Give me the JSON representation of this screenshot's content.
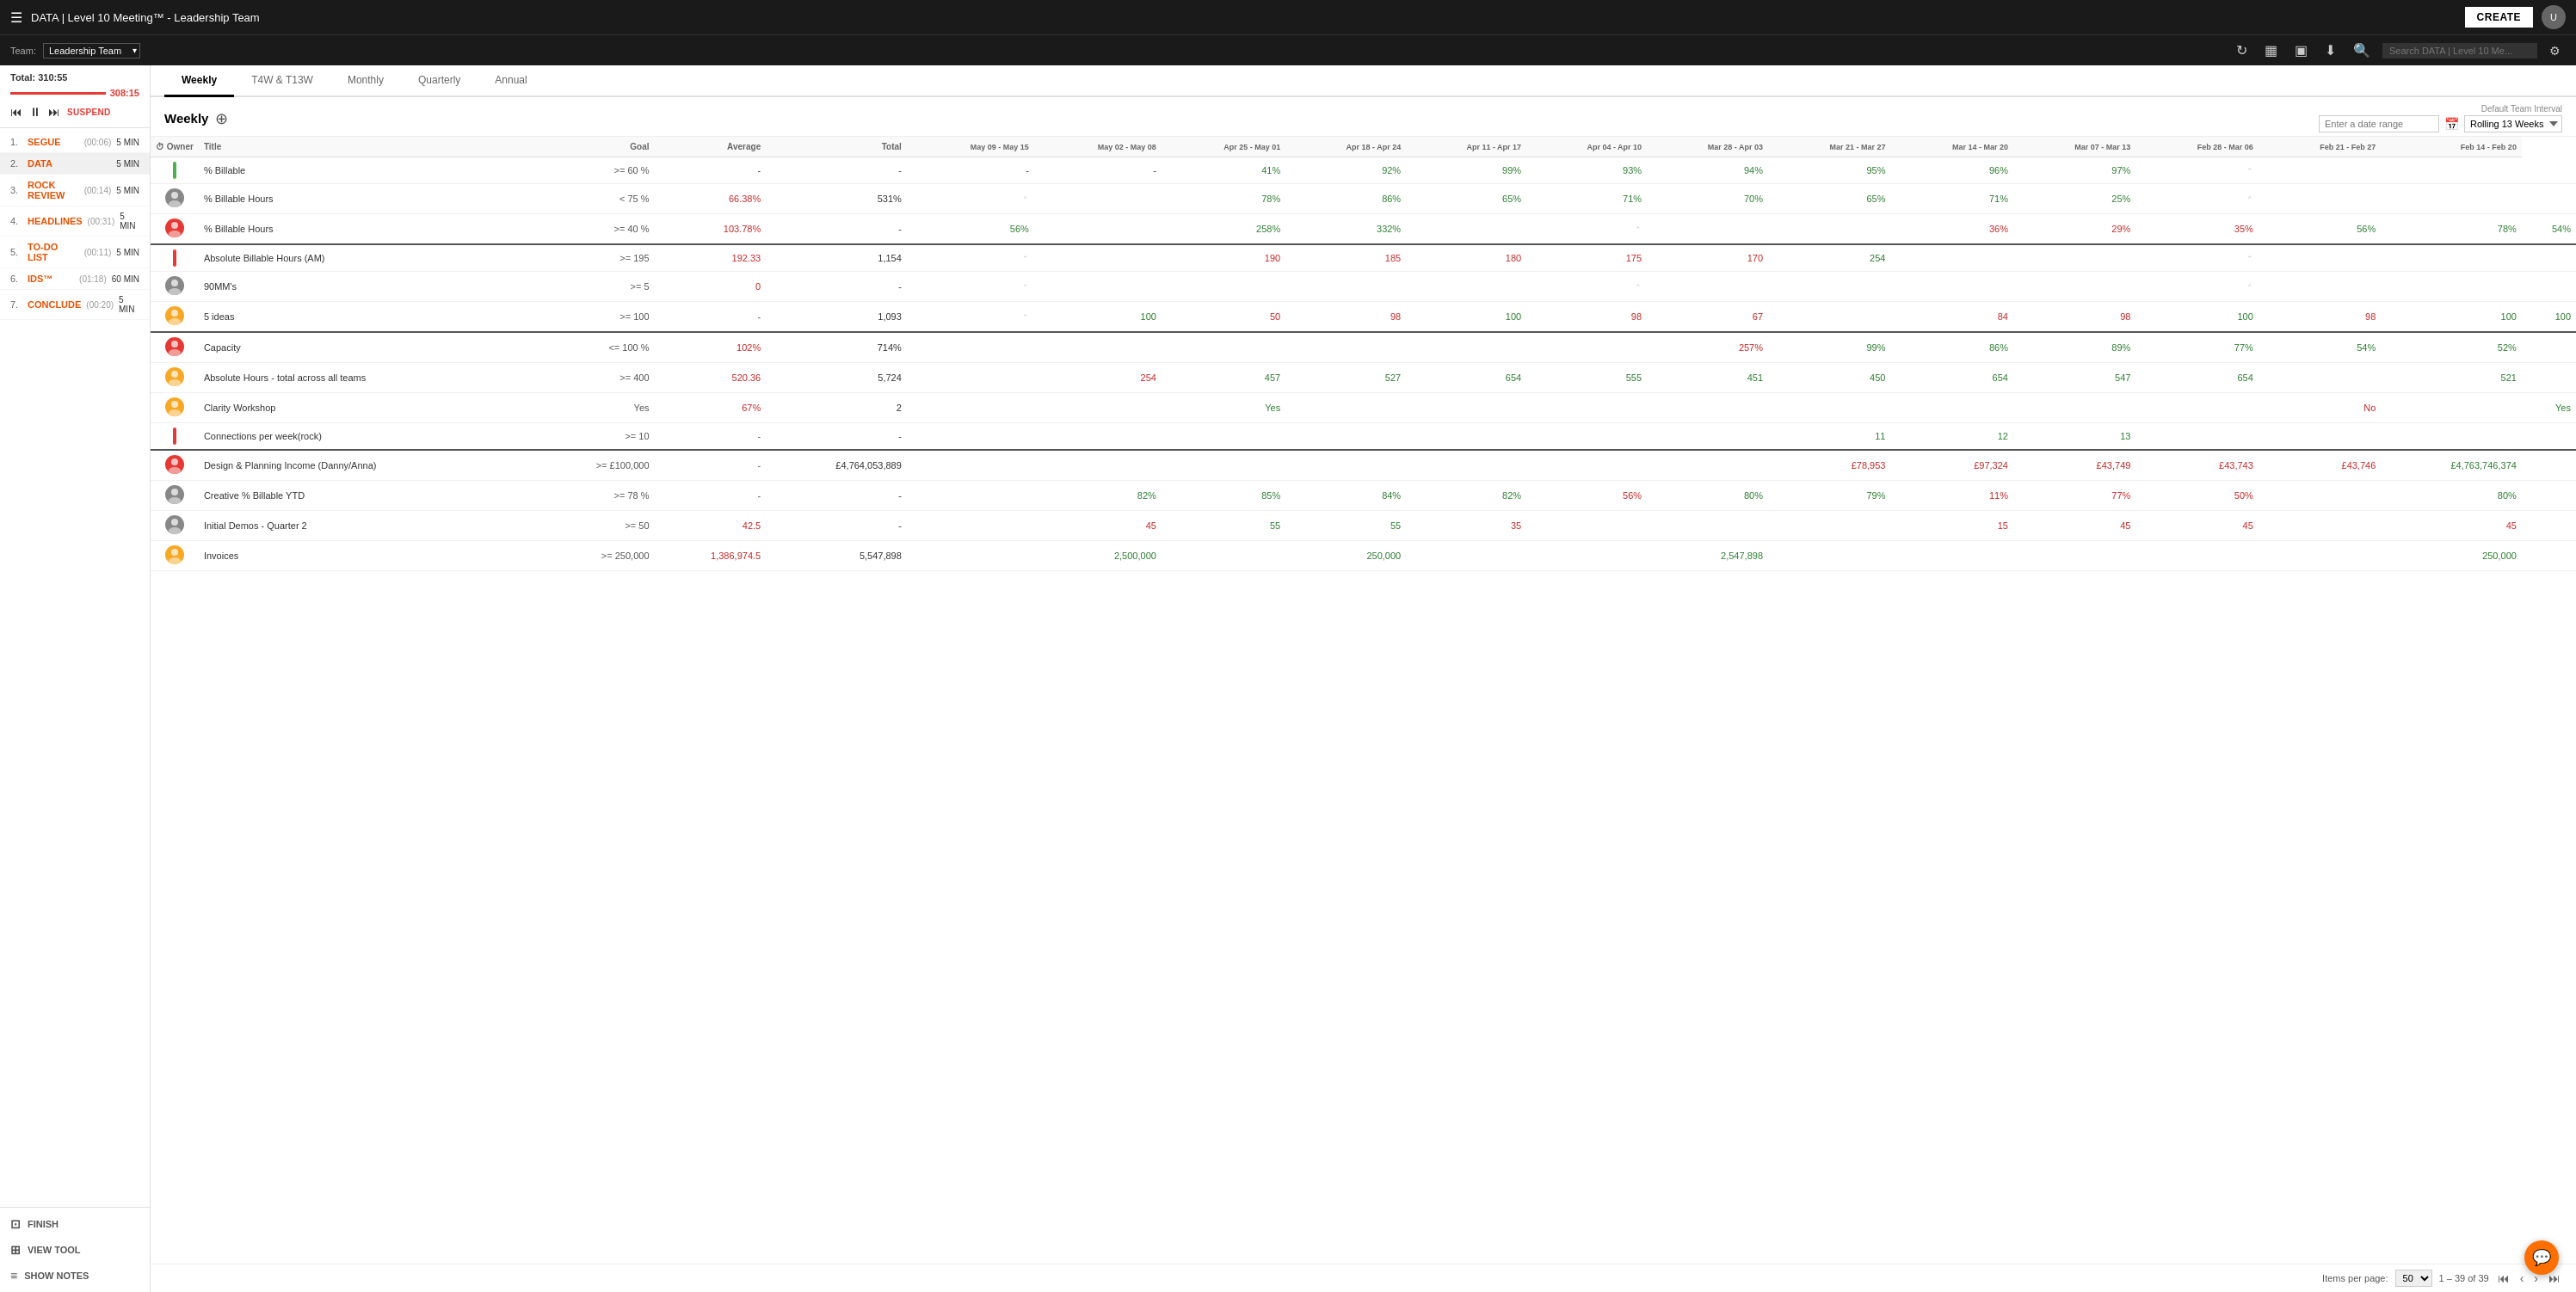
{
  "topbar": {
    "menu_icon": "☰",
    "title": "DATA | Level 10 Meeting™ - Leadership Team",
    "create_label": "CREATE"
  },
  "teambar": {
    "team_label": "Team:",
    "team_name": "Leadership Team",
    "search_placeholder": "Search DATA | Level 10 Me...",
    "refresh_icon": "↻",
    "chart_icon": "▦",
    "screen_icon": "▣",
    "download_icon": "⬇",
    "search_icon": "🔍",
    "gear_icon": "⚙"
  },
  "sidebar": {
    "total_label": "Total:",
    "total_value": "310:55",
    "timer_value": "308:15",
    "items": [
      {
        "num": "1.",
        "name": "SEGUE",
        "time": "(00:06)",
        "dur": "5 MIN",
        "color": "orange"
      },
      {
        "num": "2.",
        "name": "DATA",
        "time": "",
        "dur": "5 MIN",
        "color": "orange",
        "active": true
      },
      {
        "num": "3.",
        "name": "ROCK REVIEW",
        "time": "(00:14)",
        "dur": "5 MIN",
        "color": "orange"
      },
      {
        "num": "4.",
        "name": "HEADLINES",
        "time": "(00:31)",
        "dur": "5 MIN",
        "color": "orange"
      },
      {
        "num": "5.",
        "name": "TO-DO LIST",
        "time": "(00:11)",
        "dur": "5 MIN",
        "color": "orange"
      },
      {
        "num": "6.",
        "name": "IDS™",
        "time": "(01:18)",
        "dur": "60 MIN",
        "color": "orange"
      },
      {
        "num": "7.",
        "name": "CONCLUDE",
        "time": "(00:20)",
        "dur": "5 MIN",
        "color": "orange"
      }
    ],
    "footer": [
      {
        "label": "FINISH",
        "icon": "⊡"
      },
      {
        "label": "VIEW TOOL",
        "icon": "⊞"
      },
      {
        "label": "SHOW NOTES",
        "icon": "≡"
      }
    ]
  },
  "tabs": [
    {
      "label": "Weekly",
      "active": true
    },
    {
      "label": "T4W & T13W",
      "active": false
    },
    {
      "label": "Monthly",
      "active": false
    },
    {
      "label": "Quarterly",
      "active": false
    },
    {
      "label": "Annual",
      "active": false
    }
  ],
  "weekly_title": "Weekly",
  "date_range": {
    "label": "Enter a date range",
    "default_label": "Default Team Interval",
    "interval": "Rolling 13 Weeks"
  },
  "table": {
    "columns": [
      "Owner",
      "Title",
      "Goal",
      "Average",
      "Total",
      "May 09 - May 15",
      "May 02 - May 08",
      "Apr 25 - May 01",
      "Apr 18 - Apr 24",
      "Apr 11 - Apr 17",
      "Apr 04 - Apr 10",
      "Mar 28 - Apr 03",
      "Mar 21 - Mar 27",
      "Mar 14 - Mar 20",
      "Mar 07 - Mar 13",
      "Feb 28 - Mar 06",
      "Feb 21 - Feb 27",
      "Feb 14 - Feb 20"
    ],
    "rows": [
      {
        "group_sep": false,
        "owner_color": "#4caf50",
        "owner_type": "bar",
        "title": "% Billable",
        "goal": ">= 60 %",
        "avg": "-",
        "total": "-",
        "vals": [
          "-",
          "-",
          "41%",
          "92%",
          "99%",
          "93%",
          "94%",
          "95%",
          "96%",
          "97%",
          "",
          "",
          "",
          ""
        ],
        "val_colors": [
          "",
          "",
          "green",
          "green",
          "green",
          "green",
          "green",
          "green",
          "green",
          "green",
          "",
          "",
          "",
          ""
        ]
      },
      {
        "group_sep": false,
        "owner_color": "#888",
        "owner_type": "avatar",
        "title": "% Billable Hours",
        "goal": "< 75 %",
        "avg": "66.38%",
        "total": "531%",
        "vals": [
          "",
          "",
          "78%",
          "86%",
          "65%",
          "71%",
          "70%",
          "65%",
          "71%",
          "25%",
          "",
          "",
          "",
          ""
        ],
        "val_colors": [
          "",
          "",
          "green",
          "green",
          "green",
          "green",
          "green",
          "green",
          "green",
          "green",
          "",
          "",
          "",
          ""
        ]
      },
      {
        "group_sep": false,
        "owner_color": "#e53935",
        "owner_type": "avatar",
        "title": "% Billable Hours",
        "goal": ">= 40 %",
        "avg": "103.78%",
        "total": "-",
        "vals": [
          "56%",
          "",
          "258%",
          "332%",
          "",
          "",
          "",
          "",
          "36%",
          "29%",
          "35%",
          "56%",
          "78%",
          "54%"
        ],
        "val_colors": [
          "green",
          "",
          "green",
          "green",
          "",
          "",
          "",
          "",
          "red",
          "red",
          "red",
          "green",
          "green",
          "green"
        ]
      },
      {
        "group_sep": true,
        "owner_color": "#e53935",
        "owner_type": "bar",
        "title": "Absolute Billable Hours (AM)",
        "goal": ">= 195",
        "avg": "192.33",
        "total": "1,154",
        "vals": [
          "",
          "",
          "190",
          "185",
          "180",
          "175",
          "170",
          "254",
          "",
          "",
          "",
          "",
          "",
          ""
        ],
        "val_colors": [
          "",
          "",
          "red",
          "red",
          "red",
          "red",
          "red",
          "green",
          "",
          "",
          "",
          "",
          "",
          ""
        ]
      },
      {
        "group_sep": false,
        "owner_color": "#888",
        "owner_type": "avatar",
        "title": "90MM's",
        "goal": ">= 5",
        "avg": "0",
        "total": "-",
        "vals": [
          "",
          "",
          "",
          "",
          "",
          "",
          "",
          "",
          "",
          "",
          "",
          "",
          "",
          ""
        ],
        "val_colors": []
      },
      {
        "group_sep": false,
        "owner_color": "#f9a825",
        "owner_type": "avatar",
        "title": "5 ideas",
        "goal": ">= 100",
        "avg": "-",
        "total": "1,093",
        "vals": [
          "",
          "100",
          "50",
          "98",
          "100",
          "98",
          "67",
          "",
          "84",
          "98",
          "100",
          "98",
          "100",
          "100"
        ],
        "val_colors": [
          "",
          "green",
          "red",
          "red",
          "green",
          "red",
          "red",
          "",
          "red",
          "red",
          "green",
          "red",
          "green",
          "green"
        ]
      },
      {
        "group_sep": true,
        "owner_color": "#e53935",
        "owner_type": "avatar",
        "title": "Capacity",
        "goal": "<= 100 %",
        "avg": "102%",
        "total": "714%",
        "vals": [
          "",
          "",
          "",
          "",
          "",
          "",
          "257%",
          "99%",
          "86%",
          "89%",
          "77%",
          "54%",
          "52%",
          ""
        ],
        "val_colors": [
          "",
          "",
          "",
          "",
          "",
          "",
          "red",
          "green",
          "green",
          "green",
          "green",
          "green",
          "green",
          ""
        ]
      },
      {
        "group_sep": false,
        "owner_color": "#f9a825",
        "owner_type": "avatar",
        "title": "Absolute Hours - total across all teams",
        "goal": ">= 400",
        "avg": "520.36",
        "total": "5,724",
        "vals": [
          "",
          "254",
          "457",
          "527",
          "654",
          "555",
          "451",
          "450",
          "654",
          "547",
          "654",
          "",
          "521",
          ""
        ],
        "val_colors": [
          "",
          "red",
          "green",
          "green",
          "green",
          "green",
          "green",
          "green",
          "green",
          "green",
          "green",
          "",
          "green",
          ""
        ]
      },
      {
        "group_sep": false,
        "owner_color": "#f9a825",
        "owner_type": "avatar",
        "title": "Clarity Workshop",
        "goal": "Yes",
        "avg": "67%",
        "total": "2",
        "vals": [
          "",
          "",
          "Yes",
          "",
          "",
          "",
          "",
          "",
          "",
          "",
          "",
          "No",
          "",
          "Yes"
        ],
        "val_colors": [
          "",
          "",
          "green",
          "",
          "",
          "",
          "",
          "",
          "",
          "",
          "",
          "red",
          "",
          "green"
        ]
      },
      {
        "group_sep": false,
        "owner_color": "#e53935",
        "owner_type": "bar",
        "title": "Connections per week(rock)",
        "goal": ">= 10",
        "avg": "-",
        "total": "-",
        "vals": [
          "",
          "",
          "",
          "",
          "",
          "",
          "",
          "11",
          "12",
          "13",
          "",
          "",
          "",
          ""
        ],
        "val_colors": [
          "",
          "",
          "",
          "",
          "",
          "",
          "",
          "green",
          "green",
          "green",
          "",
          "",
          "",
          ""
        ]
      },
      {
        "group_sep": true,
        "owner_color": "#e53935",
        "owner_type": "avatar",
        "title": "Design & Planning Income (Danny/Anna)",
        "goal": ">= £100,000",
        "avg": "-",
        "total": "£4,764,053,889",
        "vals": [
          "",
          "",
          "",
          "",
          "",
          "",
          "",
          "£78,953",
          "£97,324",
          "£43,749",
          "£43,743",
          "£43,746",
          "£4,763,746,374",
          ""
        ],
        "val_colors": [
          "",
          "",
          "",
          "",
          "",
          "",
          "",
          "red",
          "red",
          "red",
          "red",
          "red",
          "green",
          ""
        ]
      },
      {
        "group_sep": false,
        "owner_color": "#888",
        "owner_type": "avatar",
        "title": "Creative % Billable YTD",
        "goal": ">= 78 %",
        "avg": "-",
        "total": "-",
        "vals": [
          "",
          "82%",
          "85%",
          "84%",
          "82%",
          "56%",
          "80%",
          "79%",
          "11%",
          "77%",
          "50%",
          "",
          "80%",
          ""
        ],
        "val_colors": [
          "",
          "green",
          "green",
          "green",
          "green",
          "red",
          "green",
          "green",
          "red",
          "red",
          "red",
          "",
          "green",
          ""
        ]
      },
      {
        "group_sep": false,
        "owner_color": "#888",
        "owner_type": "avatar",
        "title": "Initial Demos - Quarter 2",
        "goal": ">= 50",
        "avg": "42.5",
        "total": "-",
        "vals": [
          "",
          "45",
          "55",
          "55",
          "35",
          "",
          "",
          "",
          "15",
          "45",
          "45",
          "",
          "45",
          ""
        ],
        "val_colors": [
          "",
          "red",
          "green",
          "green",
          "red",
          "",
          "",
          "",
          "red",
          "red",
          "red",
          "",
          "red",
          ""
        ]
      },
      {
        "group_sep": false,
        "owner_color": "#f9a825",
        "owner_type": "avatar",
        "title": "Invoices",
        "goal": ">= 250,000",
        "avg": "1,386,974.5",
        "total": "5,547,898",
        "vals": [
          "",
          "2,500,000",
          "",
          "250,000",
          "",
          "",
          "2,547,898",
          "",
          "",
          "",
          "",
          "",
          "250,000",
          ""
        ],
        "val_colors": [
          "",
          "green",
          "",
          "green",
          "",
          "",
          "green",
          "",
          "",
          "",
          "",
          "",
          "green",
          ""
        ]
      }
    ]
  },
  "pagination": {
    "items_per_page_label": "Items per page:",
    "items_per_page": "50",
    "range": "1 – 39 of 39"
  }
}
